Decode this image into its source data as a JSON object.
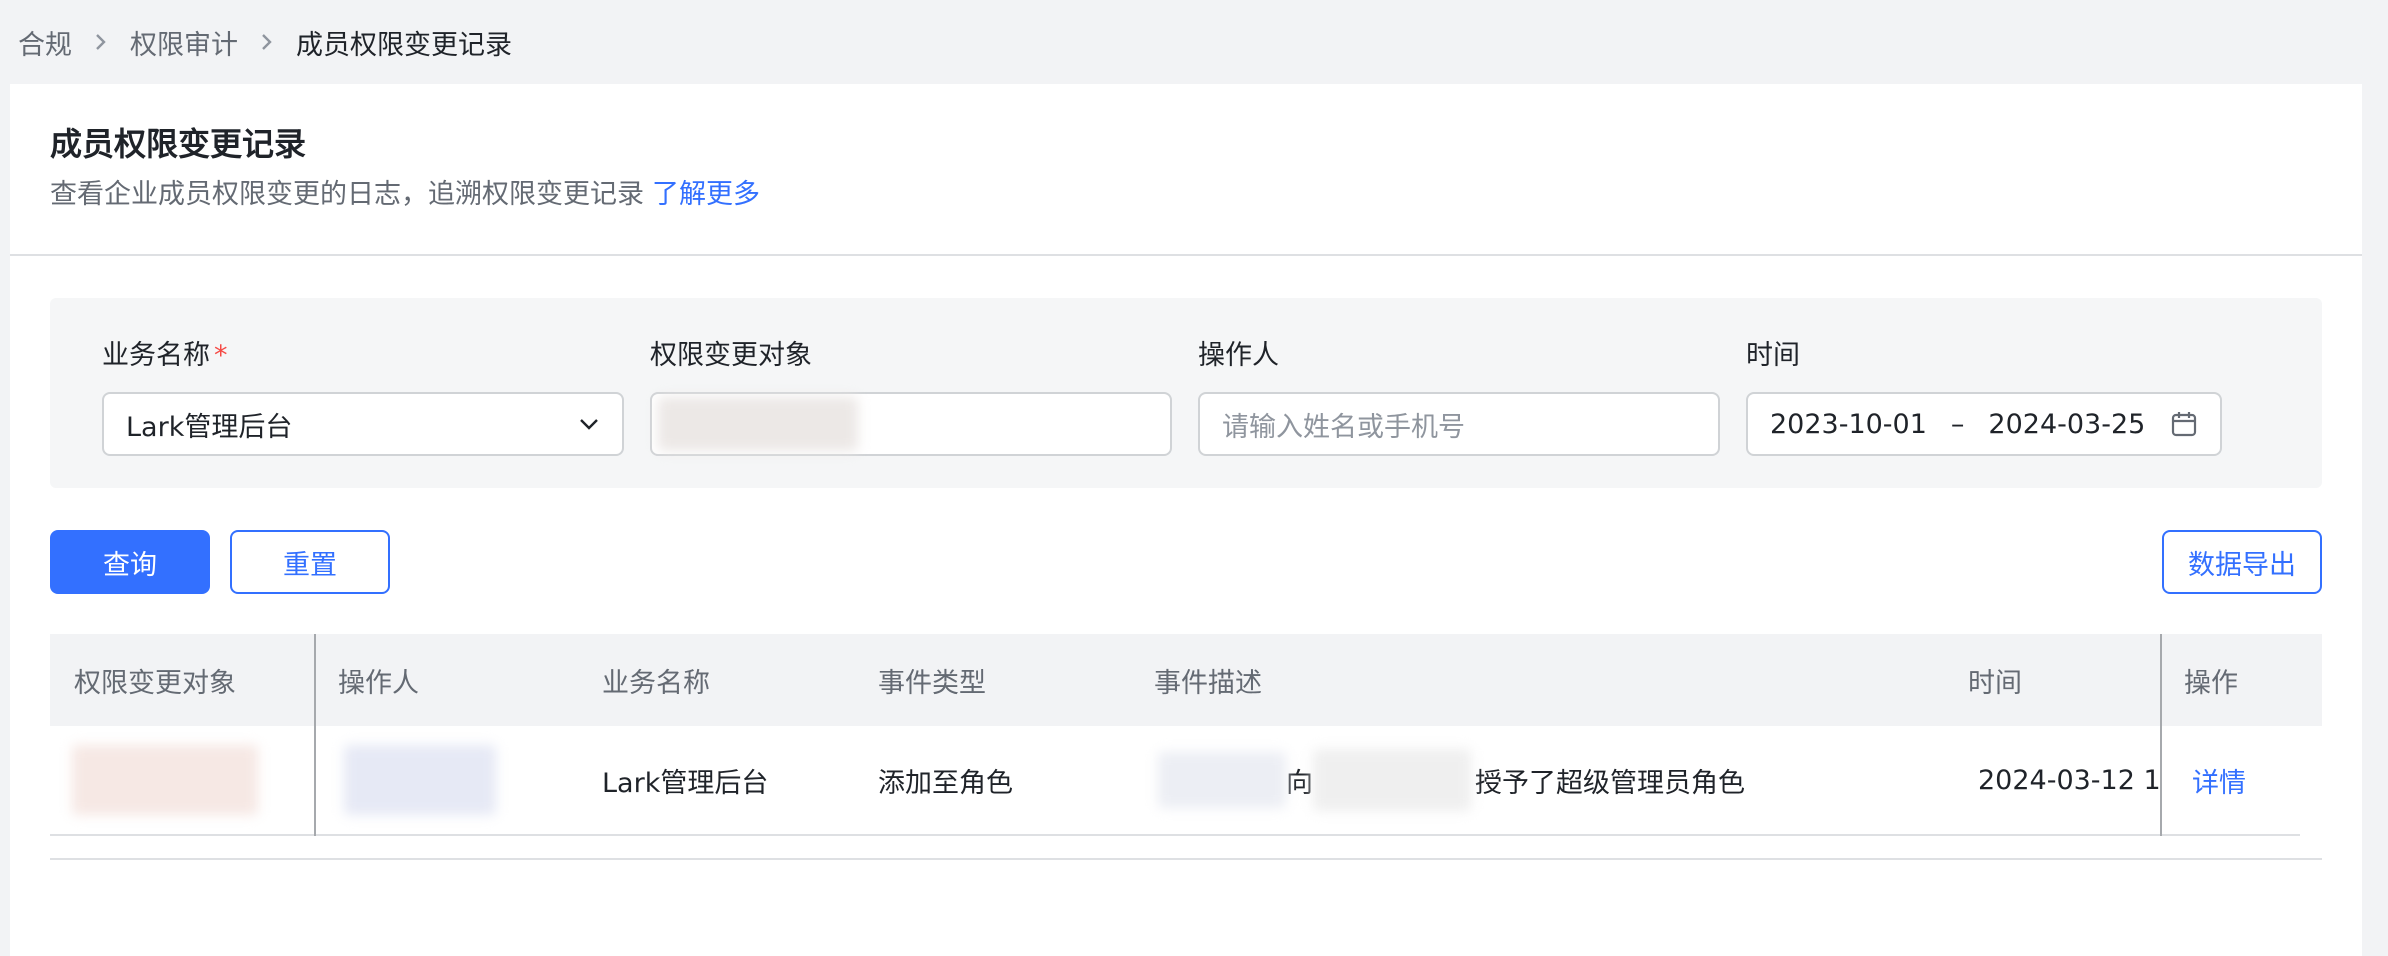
{
  "breadcrumb": {
    "items": [
      "合规",
      "权限审计",
      "成员权限变更记录"
    ]
  },
  "header": {
    "title": "成员权限变更记录",
    "description": "查看企业成员权限变更的日志，追溯权限变更记录",
    "learn_more": "了解更多"
  },
  "filters": {
    "business": {
      "label": "业务名称",
      "required_mark": "*",
      "value": "Lark管理后台"
    },
    "target": {
      "label": "权限变更对象"
    },
    "operator": {
      "label": "操作人",
      "placeholder": "请输入姓名或手机号"
    },
    "time": {
      "label": "时间",
      "start": "2023-10-01",
      "separator": "–",
      "end": "2024-03-25"
    }
  },
  "buttons": {
    "query": "查询",
    "reset": "重置",
    "export": "数据导出"
  },
  "table": {
    "columns": [
      "权限变更对象",
      "操作人",
      "业务名称",
      "事件类型",
      "事件描述",
      "时间",
      "操作"
    ],
    "rows": [
      {
        "business": "Lark管理后台",
        "event_type": "添加至角色",
        "event_desc_mid": "向",
        "event_desc_end": "授予了超级管理员角色",
        "time": "2024-03-12 1",
        "action": "详情"
      }
    ]
  },
  "colors": {
    "accent": "#3370ff",
    "required": "#f54a45",
    "background": "#f2f3f5"
  }
}
